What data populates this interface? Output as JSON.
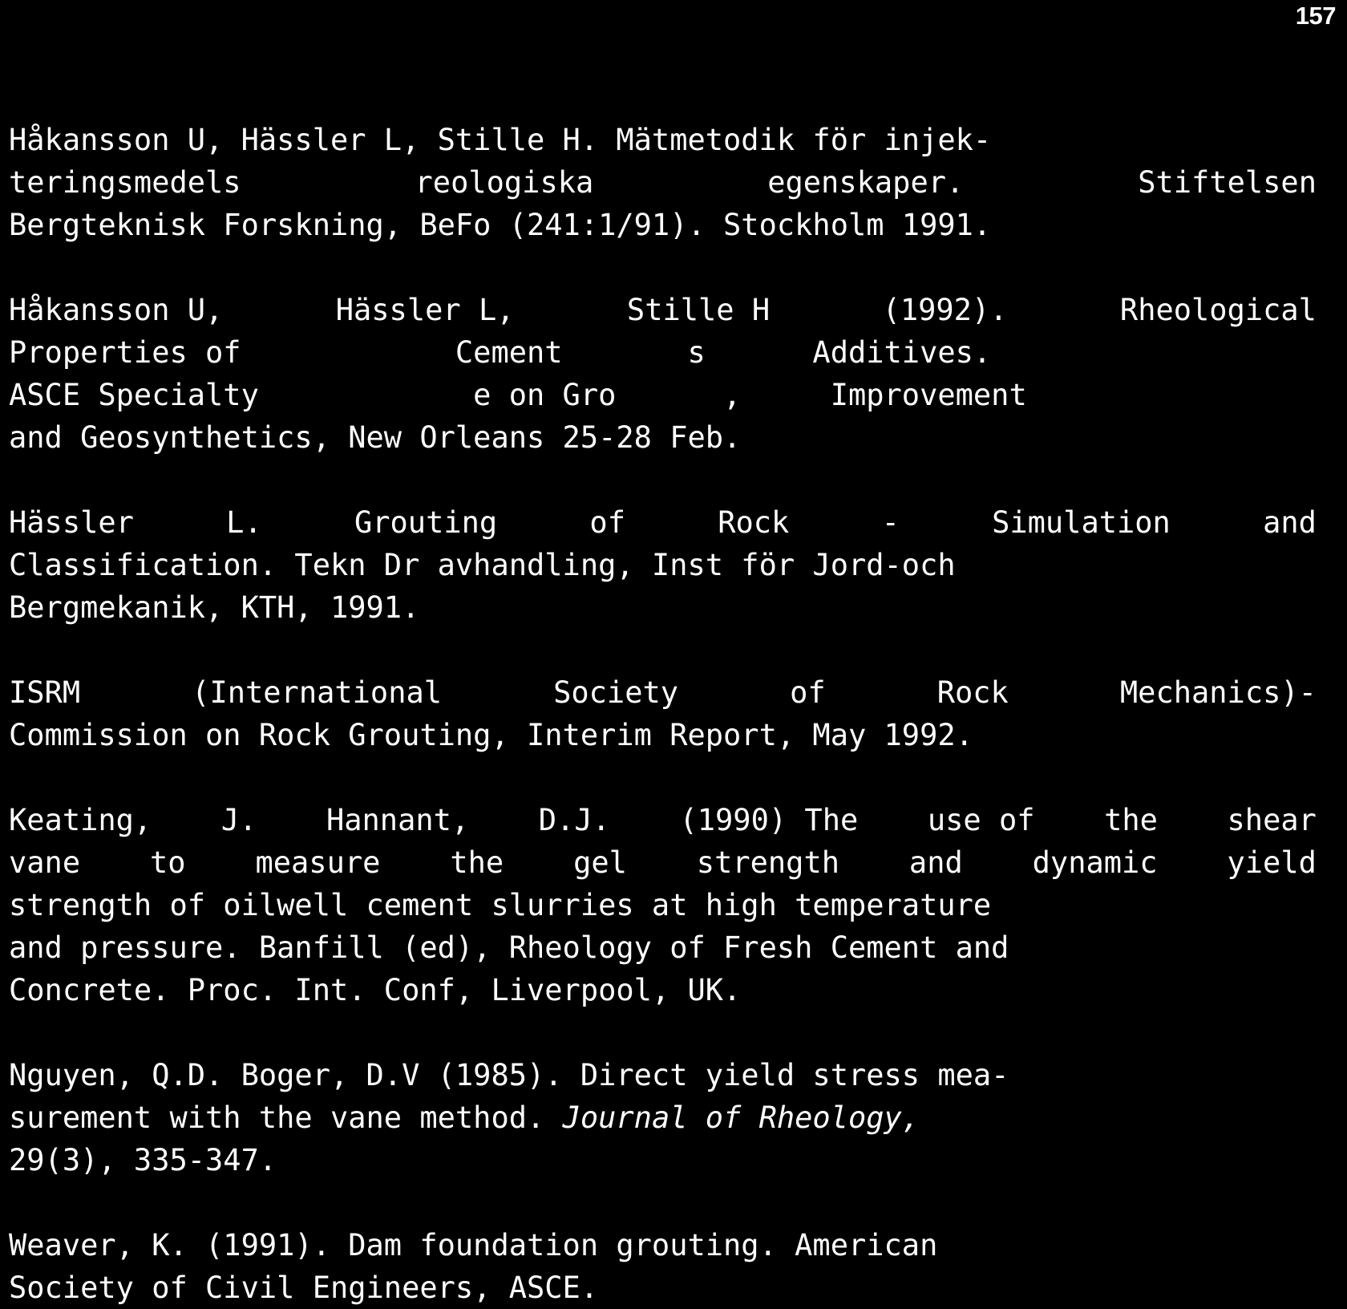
{
  "page": {
    "folio": "157",
    "background_color": "#000000",
    "text_color": "#ffffff"
  },
  "references": [
    {
      "id": "hakansson-1991",
      "lines": [
        "Håkansson U, Hässler L, Stille H. Mätmetodik för injek-",
        "teringsmedels  reologiska  egenskaper.  Stiftelsen",
        "Bergteknisk Forskning, BeFo (241:1/91). Stockholm 1991."
      ],
      "justified": [
        false,
        true,
        false
      ],
      "justified_words": [
        [],
        [
          "teringsmedels",
          "reologiska",
          "egenskaper.",
          "Stiftelsen"
        ],
        []
      ]
    },
    {
      "id": "hakansson-1992",
      "damaged": true,
      "lines": [
        "Håkansson U, Hässler L, Stille H (1992). Rheological",
        "Properties of            Cement       s      Additives.",
        "ASCE Specialty            e on Gro      ,     Improvement",
        "and Geosynthetics, New Orleans 25-28 Feb."
      ],
      "justified": [
        true,
        false,
        false,
        false
      ],
      "justified_words": [
        [
          "Håkansson U,",
          "Hässler L,",
          "Stille H",
          "(1992).",
          "Rheological"
        ],
        [],
        [],
        []
      ]
    },
    {
      "id": "hassler-1991",
      "lines": [
        "Hässler  L.  Grouting  of  Rock  -  Simulation  and",
        "Classification. Tekn Dr avhandling, Inst för Jord-och",
        "Bergmekanik, KTH, 1991."
      ],
      "justified": [
        true,
        false,
        false
      ],
      "justified_words": [
        [
          "Hässler",
          "L.",
          "Grouting",
          "of",
          "Rock",
          "-",
          "Simulation",
          "and"
        ],
        [],
        []
      ]
    },
    {
      "id": "isrm-1992",
      "lines": [
        "ISRM  (International  Society  of  Rock  Mechanics)-",
        "Commission on Rock Grouting, Interim Report, May 1992."
      ],
      "justified": [
        true,
        false
      ],
      "justified_words": [
        [
          "ISRM",
          "(International",
          "Society",
          "of",
          "Rock",
          "Mechanics)-"
        ],
        []
      ]
    },
    {
      "id": "keating-hannant-1990",
      "lines": [
        "Keating, J. Hannant, D.J.  (1990) The use of the shear",
        "vane to measure the gel strength and dynamic yield",
        "strength of oilwell cement slurries at high temperature",
        "and pressure. Banfill (ed), Rheology of Fresh Cement and",
        "Concrete. Proc. Int. Conf, Liverpool, UK."
      ],
      "justified": [
        true,
        true,
        false,
        false,
        false
      ],
      "justified_words": [
        [
          "Keating,",
          "J.",
          "Hannant,",
          "D.J.",
          "(1990) The",
          "use of",
          "the",
          "shear"
        ],
        [
          "vane",
          "to",
          "measure",
          "the",
          "gel",
          "strength",
          "and",
          "dynamic",
          "yield"
        ],
        [],
        [],
        []
      ]
    },
    {
      "id": "nguyen-boger-1985",
      "lines": [
        "Nguyen, Q.D. Boger, D.V (1985). Direct yield stress mea-",
        "surement with the vane method. ",
        "29(3), 335-347."
      ],
      "italic_segment": "Journal of Rheology,",
      "justified": [
        false,
        false,
        false
      ],
      "justified_words": [
        [],
        [],
        []
      ]
    },
    {
      "id": "weaver-1991",
      "lines": [
        "Weaver, K. (1991). Dam foundation grouting. American",
        "Society of Civil Engineers, ASCE."
      ],
      "justified": [
        false,
        false
      ],
      "justified_words": [
        [],
        []
      ]
    }
  ]
}
